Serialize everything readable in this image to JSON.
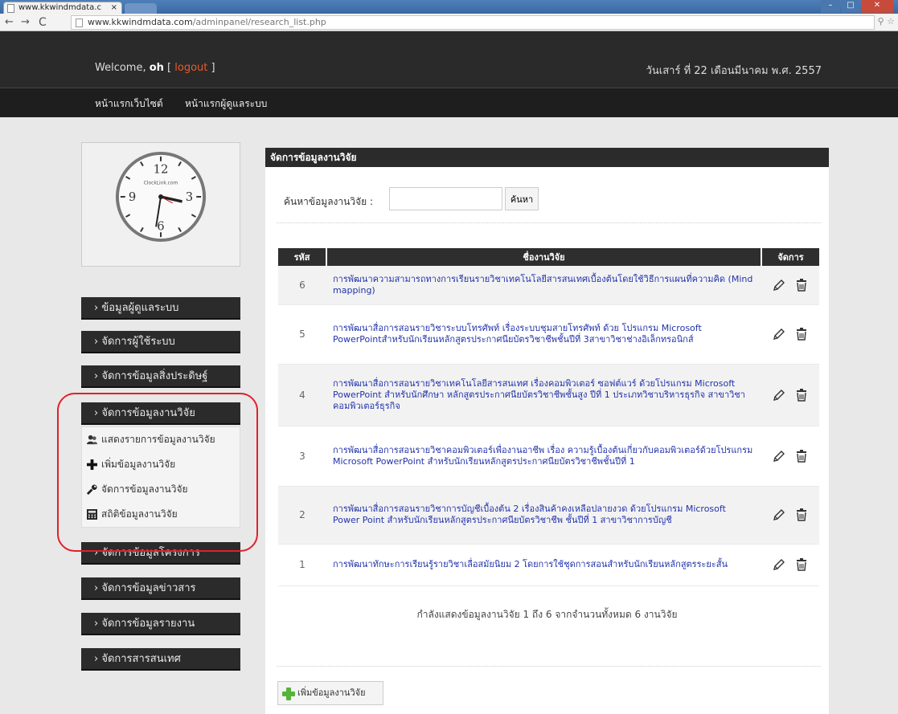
{
  "browser": {
    "tab_title": "www.kkwindmdata.c",
    "tab_close": "×",
    "url_host": "www.kkwindmdata.com",
    "url_path": "/adminpanel/research_list.php"
  },
  "header": {
    "welcome_prefix": "Welcome, ",
    "user": "oh",
    "logout_open": " [ ",
    "logout": "logout",
    "logout_close": " ]",
    "date": "วันเสาร์ ที่ 22 เดือนมีนาคม พ.ศ. 2557",
    "nav": [
      "หน้าแรกเว็บไซต์",
      "หน้าแรกผู้ดูแลระบบ"
    ]
  },
  "sidebar": {
    "clock_brand": "ClockLink.com",
    "menus": [
      "› ข้อมูลผู้ดูแลระบบ",
      "› จัดการผู้ใช้ระบบ",
      "› จัดการข้อมูลสิ่งประดิษฐ์",
      "› จัดการข้อมูลงานวิจัย",
      "› จัดการข้อมูลโครงการ",
      "› จัดการข้อมูลข่าวสาร",
      "› จัดการข้อมูลรายงาน",
      "› จัดการสารสนเทศ"
    ],
    "submenu": [
      "แสดงรายการข้อมูลงานวิจัย",
      "เพิ่มข้อมูลงานวิจัย",
      "จัดการข้อมูลงานวิจัย",
      "สถิติข้อมูลงานวิจัย"
    ]
  },
  "main": {
    "title": "จัดการข้อมูลงานวิจัย",
    "search_label": "ค้นหาข้อมูลงานวิจัย :",
    "search_value": "",
    "search_button": "ค้นหา",
    "columns": [
      "รหัส",
      "ชื่องานวิจัย",
      "จัดการ"
    ],
    "rows": [
      {
        "id": "6",
        "title": "การพัฒนาความสามารถทางการเรียนรายวิชาเทคโนโลยีสารสนเทศเบื้องต้นโดยใช้วิธีการแผนที่ความคิด (Mind mapping)"
      },
      {
        "id": "5",
        "title": "การพัฒนาสื่อการสอนรายวิชาระบบโทรศัพท์ เรื่องระบบชุมสายโทรศัพท์ ด้วย โปรแกรม Microsoft PowerPointสำหรับนักเรียนหลักสูตรประกาศนียบัตรวิชาชีพชั้นปีที่ 3สาขาวิชาช่างอิเล็กทรอนิกส์"
      },
      {
        "id": "4",
        "title": "การพัฒนาสื่อการสอนรายวิชาเทคโนโลยีสารสนเทศ เรื่องคอมพิวเตอร์ ซอฟต์แวร์ ด้วยโปรแกรม Microsoft PowerPoint สำหรับนักศึกษา หลักสูตรประกาศนียบัตรวิชาชีพชั้นสูง ปีที่ 1 ประเภทวิชาบริหารธุรกิจ สาขาวิชาคอมพิวเตอร์ธุรกิจ"
      },
      {
        "id": "3",
        "title": "การพัฒนาสื่อการสอนรายวิชาคอมพิวเตอร์เพื่องานอาชีพ เรื่อง ความรู้เบื้องต้นเกี่ยวกับคอมพิวเตอร์ด้วยโปรแกรม Microsoft PowerPoint สำหรับนักเรียนหลักสูตรประกาศนียบัตรวิชาชีพชั้นปีที่ 1"
      },
      {
        "id": "2",
        "title": "การพัฒนาสื่อการสอนรายวิชาการบัญชีเบื้องต้น 2 เรื่องสินค้าคงเหลือปลายงวด ด้วยโปรแกรม Microsoft Power Point สำหรับนักเรียนหลักสูตรประกาศนียบัตรวิชาชีพ ชั้นปีที่ 1 สาขาวิชาการบัญชี"
      },
      {
        "id": "1",
        "title": "การพัฒนาทักษะการเรียนรู้รายวิชาเลื่อสมัยนิยม 2 โดยการใช้ชุดการสอนสำหรับนักเรียนหลักสูตรระยะสั้น"
      }
    ],
    "paging_text": "กำลังแสดงข้อมูลงานวิจัย 1 ถึง 6 จากจำนวนทั้งหมด 6 งานวิจัย",
    "add_button": "เพิ่มข้อมูลงานวิจัย"
  }
}
